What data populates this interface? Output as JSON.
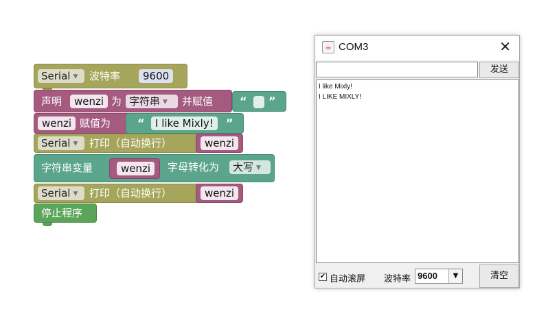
{
  "blocks": {
    "serial_label": "Serial",
    "baud_label": "波特率",
    "baud_value": "9600",
    "declare_label": "声明",
    "var_name": "wenzi",
    "as_label": "为",
    "type_value": "字符串",
    "assign_init_label": "并赋值",
    "open_quote": "“",
    "close_quote": "”",
    "assign_label": "赋值为",
    "string_value": "I like Mixly!",
    "print_label": "打印（自动换行）",
    "str_var_label": "字符串变量",
    "convert_label": "字母转化为",
    "case_value": "大写",
    "stop_label": "停止程序"
  },
  "serial_window": {
    "title": "COM3",
    "send_button": "发送",
    "send_input_value": "",
    "output_lines": [
      "I like Mixly!",
      "I LIKE MIXLY!"
    ],
    "autoscroll_label": "自动滚屏",
    "autoscroll_checked": "✔",
    "baud_label": "波特率",
    "baud_selected": "9600",
    "clear_button": "清空",
    "java_icon": "☕",
    "close_icon": "✕",
    "dropdown_icon": "▼"
  }
}
